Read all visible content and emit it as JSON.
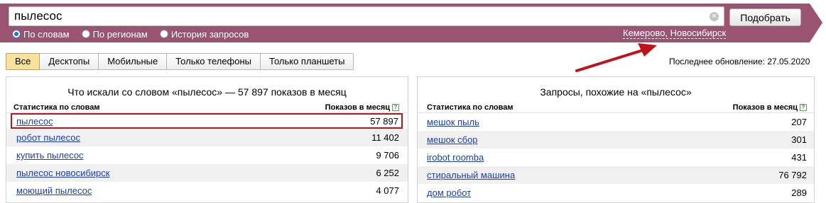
{
  "search": {
    "query": "пылесос",
    "submit_label": "Подобрать",
    "clear_icon": "close-circle-icon"
  },
  "modes": [
    {
      "label": "По словам",
      "checked": true
    },
    {
      "label": "По регионам",
      "checked": false
    },
    {
      "label": "История запросов",
      "checked": false
    }
  ],
  "region_label": "Кемерово, Новосибирск",
  "devices": [
    {
      "label": "Все",
      "active": true
    },
    {
      "label": "Десктопы",
      "active": false
    },
    {
      "label": "Мобильные",
      "active": false
    },
    {
      "label": "Только телефоны",
      "active": false
    },
    {
      "label": "Только планшеты",
      "active": false
    }
  ],
  "last_update": "Последнее обновление: 27.05.2020",
  "colors": {
    "banner": "#9a5370",
    "active_tab": "#fbe29c",
    "link": "#1a3dc1",
    "highlight": "#c0121b"
  },
  "left_panel": {
    "title": "Что искали со словом «пылесос» — 57 897 показов в месяц",
    "col_keyword": "Статистика по словам",
    "col_count": "Показов в месяц",
    "rows": [
      {
        "keyword": "пылесос",
        "count": "57 897"
      },
      {
        "keyword": "робот пылесос",
        "count": "11 402"
      },
      {
        "keyword": "купить пылесос",
        "count": "9 706"
      },
      {
        "keyword": "пылесос новосибирск",
        "count": "6 252"
      },
      {
        "keyword": "моющий пылесос",
        "count": "4 077"
      }
    ]
  },
  "right_panel": {
    "title": "Запросы, похожие на «пылесос»",
    "col_keyword": "Статистика по словам",
    "col_count": "Показов в месяц",
    "rows": [
      {
        "keyword": "мешок пыль",
        "count": "207"
      },
      {
        "keyword": "мешок сбор",
        "count": "301"
      },
      {
        "keyword": "irobot roomba",
        "count": "431"
      },
      {
        "keyword": "стиральный машина",
        "count": "76 792"
      },
      {
        "keyword": "дом робот",
        "count": "289"
      }
    ]
  }
}
